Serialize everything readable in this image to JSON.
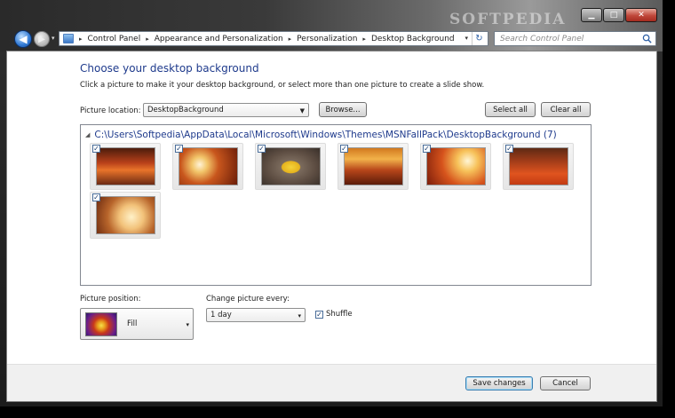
{
  "window": {
    "watermark": "SOFTPEDIA",
    "min_label": "▁",
    "max_label": "□",
    "close_label": "✕"
  },
  "nav": {
    "back_glyph": "◀",
    "forward_glyph": "▶",
    "history_glyph": "▾"
  },
  "breadcrumb": [
    "Control Panel",
    "Appearance and Personalization",
    "Personalization",
    "Desktop Background"
  ],
  "breadcrumb_sep": "▸",
  "address_dropdown_glyph": "▾",
  "refresh_glyph": "↻",
  "search": {
    "placeholder": "Search Control Panel"
  },
  "page": {
    "title": "Choose your desktop background",
    "subtitle": "Click a picture to make it your desktop background, or select more than one picture to create a slide show."
  },
  "location": {
    "label": "Picture location:",
    "value": "DesktopBackground",
    "browse": "Browse...",
    "select_all": "Select all",
    "clear_all": "Clear all"
  },
  "gallery": {
    "group_toggle": "◢",
    "group_path": "C:\\Users\\Softpedia\\AppData\\Local\\Microsoft\\Windows\\Themes\\MSNFallPack\\DesktopBackground (7)",
    "checked_glyph": "✓",
    "thumbs": [
      {
        "checked": true
      },
      {
        "checked": true
      },
      {
        "checked": true
      },
      {
        "checked": true
      },
      {
        "checked": true
      },
      {
        "checked": true
      },
      {
        "checked": true
      }
    ]
  },
  "position": {
    "label": "Picture position:",
    "value": "Fill",
    "arrow": "▾"
  },
  "change": {
    "label": "Change picture every:",
    "value": "1 day",
    "arrow": "▾"
  },
  "shuffle": {
    "label": "Shuffle",
    "checked": true,
    "glyph": "✓"
  },
  "footer": {
    "save": "Save changes",
    "cancel": "Cancel"
  },
  "colors": {
    "accent_title": "#1e3a8c",
    "link_blue": "#1e3a8c"
  }
}
